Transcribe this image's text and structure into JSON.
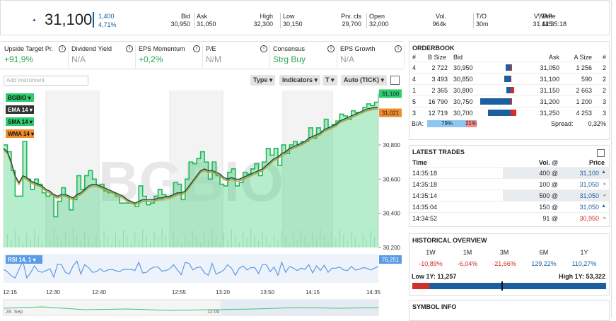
{
  "quote": {
    "last": "31,100",
    "change_abs": "1,400",
    "change_pct": "4,71%",
    "fields": [
      {
        "label": "Bid",
        "value": "30,950"
      },
      {
        "label": "Ask",
        "value": "31,050"
      },
      {
        "label": "High",
        "value": "32,300"
      },
      {
        "label": "Low",
        "value": "30,150"
      },
      {
        "label": "Prv. cls",
        "value": "29,700"
      },
      {
        "label": "Open",
        "value": "32,000"
      },
      {
        "label": "Vol.",
        "value": "964k"
      },
      {
        "label": "T/O",
        "value": "30m"
      },
      {
        "label": "VWAP",
        "value": "31.425"
      },
      {
        "label": "Time",
        "value": "14:35:18"
      }
    ]
  },
  "metrics": [
    {
      "label": "Upside Target Pr.",
      "value": "+91,9%",
      "color": "#2aa550"
    },
    {
      "label": "Dividend Yield",
      "value": "N/A",
      "color": "#999999"
    },
    {
      "label": "EPS Momentum",
      "value": "+0,2%",
      "color": "#2aa550"
    },
    {
      "label": "P/E",
      "value": "N/M",
      "color": "#999999"
    },
    {
      "label": "Consensus",
      "value": "Strg Buy",
      "color": "#2aa550"
    },
    {
      "label": "EPS Growth",
      "value": "N/A",
      "color": "#999999"
    }
  ],
  "chart_toolbar": {
    "instrument_placeholder": "Add instrument",
    "type_label": "Type",
    "indicators_label": "Indicators",
    "t_label": "T",
    "auto_label": "Auto (TICK)"
  },
  "chart_data": {
    "type": "line",
    "watermark": "BGBIO",
    "legend": [
      {
        "name": "BGBIO",
        "color": "#2ecc71"
      },
      {
        "name": "EMA 14",
        "color": "#333333"
      },
      {
        "name": "SMA 14",
        "color": "#2ecc71"
      },
      {
        "name": "WMA 14",
        "color": "#f08c2e"
      }
    ],
    "y_ticks": [
      "30,800",
      "30,600",
      "30,400",
      "30,200"
    ],
    "ylim": [
      30200,
      31100
    ],
    "x_ticks": [
      "12:15",
      "12:30",
      "12:40",
      "12:55",
      "13:20",
      "13:50",
      "14:15",
      "14:35"
    ],
    "last_label": "31,100",
    "ma_label": "31,021",
    "price": [
      30800,
      30760,
      30650,
      30500,
      30500,
      30820,
      30600,
      30540,
      30600,
      30570,
      30520,
      30500,
      30510,
      30380,
      30470,
      30550,
      30500,
      30420,
      30480,
      30620,
      30540,
      30620,
      30650,
      30600,
      30560,
      30570,
      30530,
      30520,
      30520,
      30500,
      30460,
      30460,
      30460,
      30460,
      30440,
      30560,
      30500,
      30450,
      30460,
      30500,
      30540,
      30510,
      30490,
      30500,
      30580,
      30570,
      30480,
      30600,
      30700,
      30690,
      30720,
      30760,
      30700,
      30600,
      30700,
      30620,
      30570,
      30560,
      30640,
      30660,
      30560,
      30580,
      30640,
      30630,
      30660,
      30690,
      30620,
      30700,
      30780,
      30740,
      30780,
      30680,
      30800,
      30750,
      30800,
      30820,
      30800,
      30820,
      30820,
      30900,
      30840,
      30900,
      30880,
      30950,
      30900,
      30920,
      30940,
      30980,
      30970,
      30950,
      31000,
      30990,
      30990,
      31020,
      31040,
      31030,
      31050,
      31100
    ],
    "ma": [
      30780,
      30760,
      30700,
      30620,
      30580,
      30620,
      30610,
      30590,
      30580,
      30570,
      30560,
      30540,
      30530,
      30510,
      30500,
      30510,
      30510,
      30500,
      30490,
      30510,
      30520,
      30540,
      30560,
      30570,
      30570,
      30560,
      30550,
      30540,
      30530,
      30520,
      30510,
      30500,
      30480,
      30470,
      30460,
      30470,
      30480,
      30480,
      30480,
      30480,
      30490,
      30490,
      30500,
      30500,
      30510,
      30520,
      30520,
      30530,
      30560,
      30590,
      30620,
      30650,
      30660,
      30650,
      30650,
      30640,
      30630,
      30610,
      30600,
      30610,
      30600,
      30600,
      30610,
      30620,
      30630,
      30640,
      30650,
      30660,
      30680,
      30700,
      30720,
      30730,
      30750,
      30760,
      30780,
      30790,
      30800,
      30810,
      30820,
      30840,
      30850,
      30860,
      30870,
      30890,
      30900,
      30910,
      30920,
      30940,
      30950,
      30960,
      30970,
      30980,
      30990,
      31000,
      31010,
      31015,
      31020,
      31021
    ],
    "rsi_label": "RSI 14, 1",
    "rsi_last": "76,251",
    "nav_date": "28. Sep",
    "nav_time": "12:00"
  },
  "orderbook": {
    "title": "ORDERBOOK",
    "headers": [
      "#",
      "B Size",
      "Bid",
      "Ask",
      "A Size",
      "#"
    ],
    "rows": [
      {
        "bn": "4",
        "bsize": "2 722",
        "bid": "30,950",
        "ask": "31,050",
        "asize": "1 256",
        "an": "2",
        "bfill": 0.12,
        "afill": 0.05
      },
      {
        "bn": "4",
        "bsize": "3 493",
        "bid": "30,850",
        "ask": "31,100",
        "asize": "590",
        "an": "2",
        "bfill": 0.16,
        "afill": 0.03
      },
      {
        "bn": "1",
        "bsize": "2 365",
        "bid": "30,800",
        "ask": "31,150",
        "asize": "2 663",
        "an": "2",
        "bfill": 0.11,
        "afill": 0.12
      },
      {
        "bn": "5",
        "bsize": "16 790",
        "bid": "30,750",
        "ask": "31,200",
        "asize": "1 200",
        "an": "3",
        "bfill": 0.78,
        "afill": 0.05
      },
      {
        "bn": "3",
        "bsize": "12 719",
        "bid": "30,700",
        "ask": "31,250",
        "asize": "4 253",
        "an": "3",
        "bfill": 0.59,
        "afill": 0.2
      }
    ],
    "ba_label": "B/A:",
    "bid_pct": "79%",
    "ask_pct": "21%",
    "bid_share": 0.79,
    "spread_label": "Spread:",
    "spread": "0,32%"
  },
  "trades": {
    "title": "LATEST TRADES",
    "headers": [
      "Time",
      "Vol. @",
      "Price"
    ],
    "rows": [
      {
        "time": "14:35:18",
        "vol": "400 @",
        "price": "31,100",
        "dir": "up",
        "shade": true
      },
      {
        "time": "14:35:18",
        "vol": "100 @",
        "price": "31,050",
        "dir": "flat",
        "shade": false
      },
      {
        "time": "14:35:14",
        "vol": "500 @",
        "price": "31,050",
        "dir": "flat",
        "shade": true
      },
      {
        "time": "14:35:04",
        "vol": "150 @",
        "price": "31,050",
        "dir": "up",
        "shade": false
      },
      {
        "time": "14:34:52",
        "vol": "91 @",
        "price": "30,950",
        "dir": "flat",
        "shade": false
      }
    ]
  },
  "historical": {
    "title": "HISTORICAL OVERVIEW",
    "periods": [
      "1W",
      "1M",
      "3M",
      "6M",
      "1Y"
    ],
    "values": [
      "-10,89%",
      "-6,04%",
      "-21,66%",
      "129,22%",
      "110,27%"
    ],
    "value_colors": [
      "#d0302b",
      "#d0302b",
      "#d0302b",
      "#1c5f9e",
      "#1c5f9e"
    ],
    "low_label": "Low 1Y: 11,257",
    "high_label": "High 1Y: 53,322",
    "current_pos": 0.46
  },
  "symbol_info": {
    "title": "SYMBOL INFO"
  }
}
